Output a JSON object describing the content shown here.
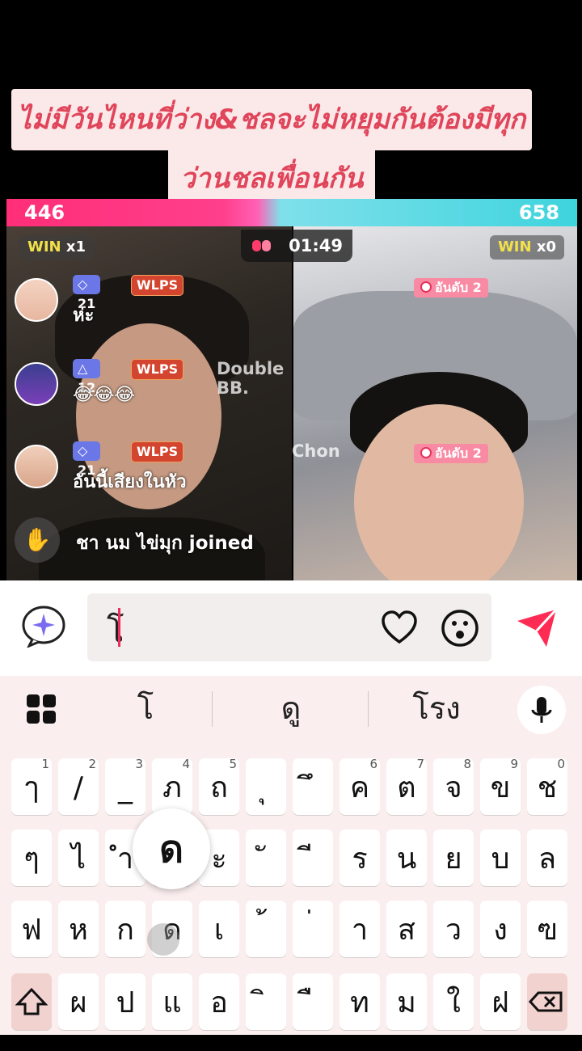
{
  "captions": {
    "line1": "ไม่มีวันไหนที่ว่าง&ชลจะไม่หยุมกันต้องมีทุกวัน",
    "line2": "ว่านชลเพื่อนกัน"
  },
  "battle": {
    "score_left": "446",
    "score_right": "658",
    "timer": "01:49",
    "win_left": {
      "label": "WIN",
      "count": "x1"
    },
    "win_right": {
      "label": "WIN",
      "count": "x0"
    },
    "colors": {
      "left": "#ff2e77",
      "right": "#3ed4de"
    }
  },
  "comments": [
    {
      "level": "21",
      "fan": "WLPS",
      "name": "",
      "text": "ห่ะ"
    },
    {
      "level": "12",
      "fan": "WLPS",
      "name": "Double BB.",
      "text": "😂😂😂"
    },
    {
      "level": "21",
      "fan": "WLPS",
      "name": "Chon",
      "text": "อันนี้เสียงในหัว"
    }
  ],
  "joined": {
    "text": "ชา นม ไข่มุก joined",
    "icon": "wave-hand-icon"
  },
  "rank_badges": [
    "อันดับ 2",
    "อันดับ 2"
  ],
  "input": {
    "value": "โ",
    "icons": [
      "sparkle-icon",
      "heart-icon",
      "emoji-icon",
      "send-icon"
    ]
  },
  "keyboard": {
    "suggestions": [
      "โ",
      "ดู",
      "โรง"
    ],
    "row1": [
      {
        "k": "ๅ",
        "n": "1"
      },
      {
        "k": "/",
        "n": "2"
      },
      {
        "k": "_",
        "n": "3"
      },
      {
        "k": "ภ",
        "n": "4"
      },
      {
        "k": "ถ",
        "n": "5"
      },
      {
        "k": "ุ",
        "n": ""
      },
      {
        "k": "ึ",
        "n": ""
      },
      {
        "k": "ค",
        "n": "6"
      },
      {
        "k": "ต",
        "n": "7"
      },
      {
        "k": "จ",
        "n": "8"
      },
      {
        "k": "ข",
        "n": "9"
      },
      {
        "k": "ช",
        "n": "0"
      }
    ],
    "row2": [
      "ๆ",
      "ไ",
      "ำ",
      "พ",
      "ะ",
      "ั",
      "ี",
      "ร",
      "น",
      "ย",
      "บ",
      "ล"
    ],
    "row3": [
      "ฟ",
      "ห",
      "ก",
      "ด",
      "เ",
      "้",
      "่",
      "า",
      "ส",
      "ว",
      "ง",
      "ฃ"
    ],
    "row4": [
      "ผ",
      "ป",
      "แ",
      "อ",
      "ิ",
      "ื",
      "ท",
      "ม",
      "ใ",
      "ฝ"
    ],
    "popup_key": "ด",
    "shift_icon": "shift-icon",
    "backspace_icon": "backspace-icon"
  }
}
